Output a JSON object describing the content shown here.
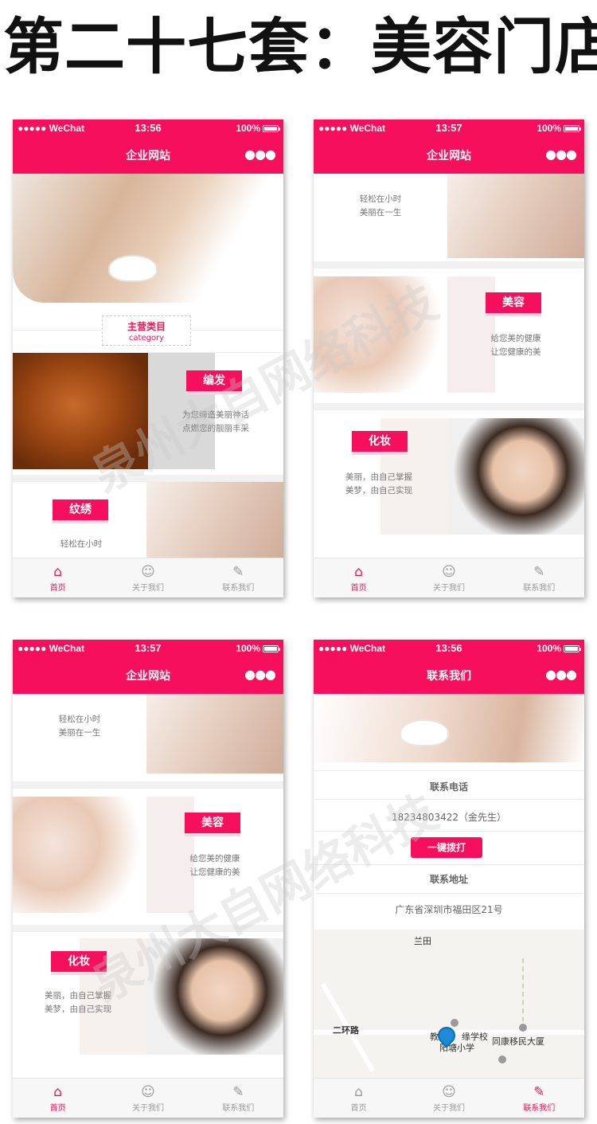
{
  "headline": "第二十七套：美容门店",
  "status": {
    "carrier": "●●●●● WeChat",
    "battery": "100%",
    "times": [
      "13:56",
      "13:57",
      "13:57",
      "13:56"
    ]
  },
  "nav": {
    "home_title": "企业网站",
    "contact_title": "联系我们",
    "more_icon": "more-dots-icon"
  },
  "tabs": [
    {
      "label": "首页",
      "icon": "home-icon"
    },
    {
      "label": "关于我们",
      "icon": "person-icon"
    },
    {
      "label": "联系我们",
      "icon": "edit-icon"
    }
  ],
  "category": {
    "title": "主营类目",
    "subtitle": "category"
  },
  "services": [
    {
      "tag": "编发",
      "desc1": "为您缔造美丽神话",
      "desc2": "点燃您的靓丽丰采"
    },
    {
      "tag": "纹绣",
      "desc1": "轻松在小时",
      "desc2": "美丽在一生"
    },
    {
      "tag": "美容",
      "desc1": "给您美的健康",
      "desc2": "让您健康的美"
    },
    {
      "tag": "化妆",
      "desc1": "美丽，由自己掌握",
      "desc2": "美梦，由自己实现"
    }
  ],
  "contact": {
    "phone_label": "联系电话",
    "phone_value": "18234803422（金先生）",
    "call_button": "一键拨打",
    "address_label": "联系地址",
    "address_value": "广东省深圳市福田区21号"
  },
  "map": {
    "labels": [
      "兰田",
      "二环路",
      "教",
      "缘学校",
      "同康移民大厦",
      "阳塘小学"
    ]
  },
  "watermark": "泉州大自网络科技",
  "colors": {
    "brand": "#f50f5d",
    "tag_shadow": "#f3d6e0"
  }
}
